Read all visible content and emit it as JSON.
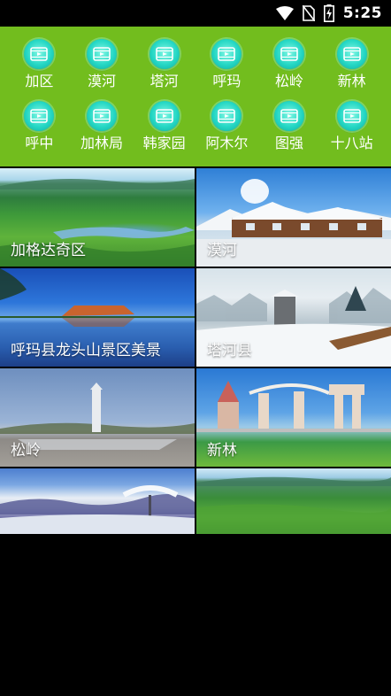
{
  "status_bar": {
    "time": "5:25",
    "icons": [
      "wifi-icon",
      "no-sim-icon",
      "battery-charging-icon"
    ]
  },
  "categories": [
    {
      "label": "加区",
      "icon": "video-icon"
    },
    {
      "label": "漠河",
      "icon": "video-icon"
    },
    {
      "label": "塔河",
      "icon": "video-icon"
    },
    {
      "label": "呼玛",
      "icon": "video-icon"
    },
    {
      "label": "松岭",
      "icon": "video-icon"
    },
    {
      "label": "新林",
      "icon": "video-icon"
    },
    {
      "label": "呼中",
      "icon": "video-icon"
    },
    {
      "label": "加林局",
      "icon": "video-icon"
    },
    {
      "label": "韩家园",
      "icon": "video-icon"
    },
    {
      "label": "阿木尔",
      "icon": "video-icon"
    },
    {
      "label": "图强",
      "icon": "video-icon"
    },
    {
      "label": "十八站",
      "icon": "video-icon"
    }
  ],
  "scenic_spots": [
    {
      "label": "加格达奇区"
    },
    {
      "label": "漠河"
    },
    {
      "label": "呼玛县龙头山景区美景"
    },
    {
      "label": "塔河县"
    },
    {
      "label": "松岭"
    },
    {
      "label": "新林"
    },
    {
      "label": ""
    },
    {
      "label": ""
    }
  ],
  "colors": {
    "panel_green": "#72bd1e",
    "icon_teal": "#25d7c4",
    "background": "#000000"
  }
}
